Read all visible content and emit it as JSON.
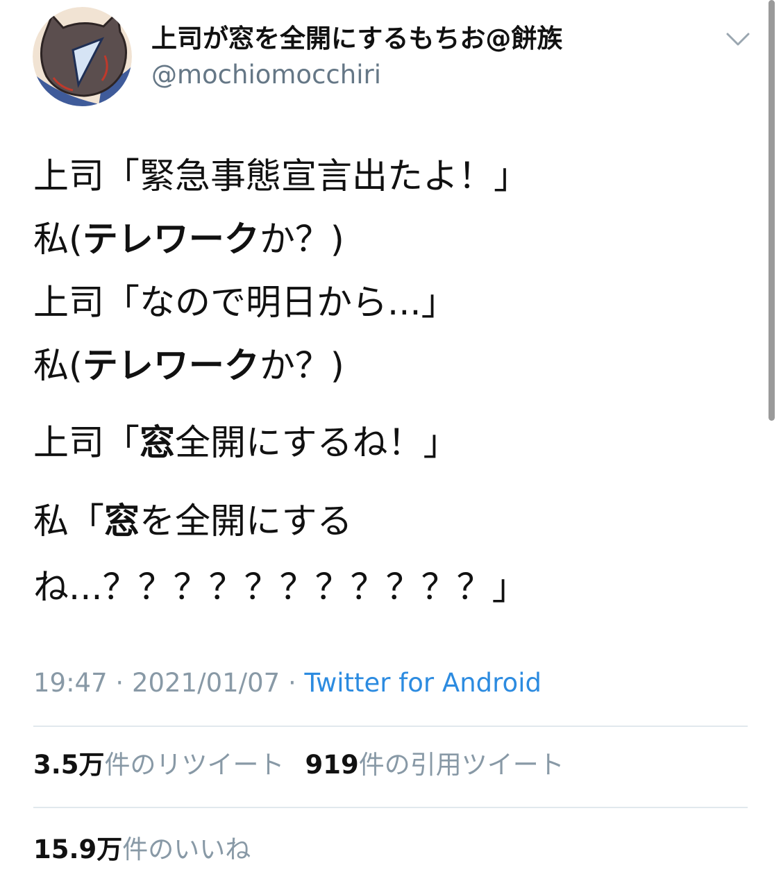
{
  "author": {
    "display_name": "上司が窓を全開にするもちお@餅族",
    "handle": "@mochiomocchiri",
    "avatar_icon": "avatar-illustration"
  },
  "menu_icon": "chevron-down-icon",
  "tweet": {
    "lines": [
      [
        {
          "text": "上司「緊急事態宣言出たよ！」",
          "bold": false
        }
      ],
      [
        {
          "text": "私(",
          "bold": false
        },
        {
          "text": "テレワーク",
          "bold": true
        },
        {
          "text": "か？)",
          "bold": false
        }
      ],
      [
        {
          "text": "上司「なので明日から...」",
          "bold": false
        }
      ],
      [
        {
          "text": "私(",
          "bold": false
        },
        {
          "text": "テレワーク",
          "bold": true
        },
        {
          "text": "か？)",
          "bold": false
        }
      ],
      [
        {
          "text": "上司「",
          "bold": false
        },
        {
          "text": "窓",
          "bold": true
        },
        {
          "text": "全開にするね！」",
          "bold": false
        }
      ],
      [
        {
          "text": "私「",
          "bold": false
        },
        {
          "text": "窓",
          "bold": true
        },
        {
          "text": "を全開にする",
          "bold": false
        }
      ],
      [
        {
          "text": "ね...？？？？？？？？？？？」",
          "bold": false
        }
      ]
    ]
  },
  "meta": {
    "time": "19:47",
    "separator": " · ",
    "date": "2021/01/07",
    "client": "Twitter for Android"
  },
  "stats": {
    "retweets_count": "3.5万",
    "retweets_label": "件のリツイート",
    "quotes_count": "919",
    "quotes_label": "件の引用ツイート",
    "likes_count": "15.9万",
    "likes_label": "件のいいね"
  },
  "colors": {
    "link": "#2c8be0",
    "secondary_text": "#8899a6",
    "divider": "#e1e8ed"
  }
}
